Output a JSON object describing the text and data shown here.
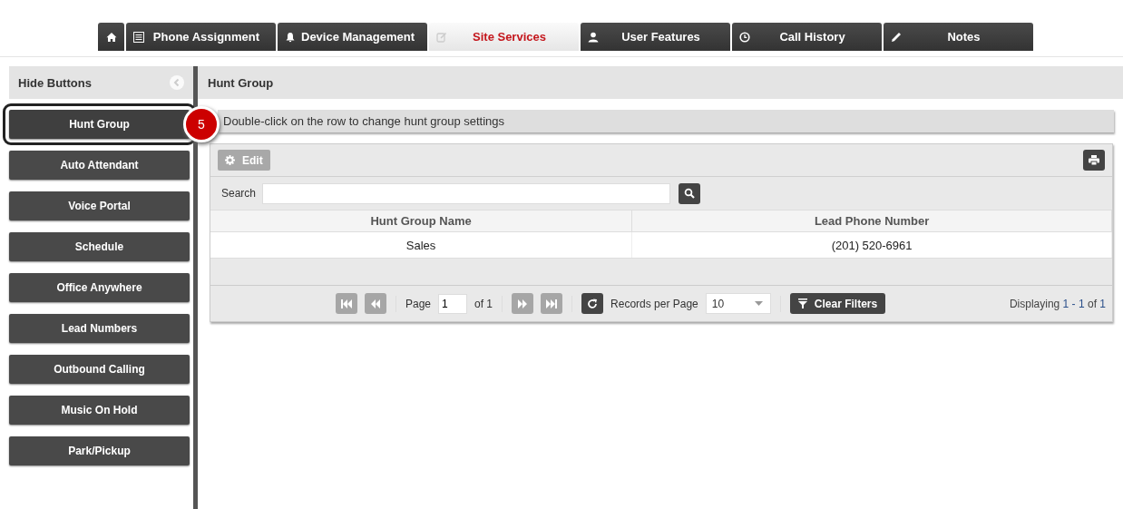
{
  "tabs": [
    {
      "kind": "home",
      "selected": false
    },
    {
      "kind": "list",
      "label": "Phone Assignment",
      "selected": false
    },
    {
      "kind": "bell",
      "label": "Device Management",
      "selected": false
    },
    {
      "kind": "edit",
      "label": "Site Services",
      "selected": true
    },
    {
      "kind": "user",
      "label": "User Features",
      "selected": false
    },
    {
      "kind": "clock",
      "label": "Call History",
      "selected": false
    },
    {
      "kind": "pencil",
      "label": "Notes",
      "selected": false
    }
  ],
  "sidebar": {
    "header": "Hide Buttons",
    "items": [
      {
        "label": "Hunt Group",
        "selected": true
      },
      {
        "label": "Auto Attendant",
        "selected": false
      },
      {
        "label": "Voice Portal",
        "selected": false
      },
      {
        "label": "Schedule",
        "selected": false
      },
      {
        "label": "Office Anywhere",
        "selected": false
      },
      {
        "label": "Lead Numbers",
        "selected": false
      },
      {
        "label": "Outbound Calling",
        "selected": false
      },
      {
        "label": "Music On Hold",
        "selected": false
      },
      {
        "label": "Park/Pickup",
        "selected": false
      }
    ]
  },
  "step_badge": "5",
  "panel": {
    "title": "Hunt Group",
    "hint": "Double-click on the row to change hunt group settings",
    "edit_button": {
      "label": "Edit",
      "disabled": true
    },
    "search_label": "Search",
    "table": {
      "columns": [
        "Hunt Group Name",
        "Lead Phone Number"
      ],
      "rows": [
        [
          "Sales",
          "(201) 520-6961"
        ]
      ]
    },
    "pager": {
      "first_disabled": true,
      "prev_disabled": true,
      "next_disabled": true,
      "last_disabled": true,
      "page_label": "Page",
      "page_value": "1",
      "of_label": "of 1",
      "per_page_label": "Records per Page",
      "per_page_value": "10",
      "clear_filters": "Clear Filters",
      "display_prefix": "Displaying ",
      "display_range": "1 - 1",
      "display_of": " of ",
      "display_total": "1"
    }
  }
}
